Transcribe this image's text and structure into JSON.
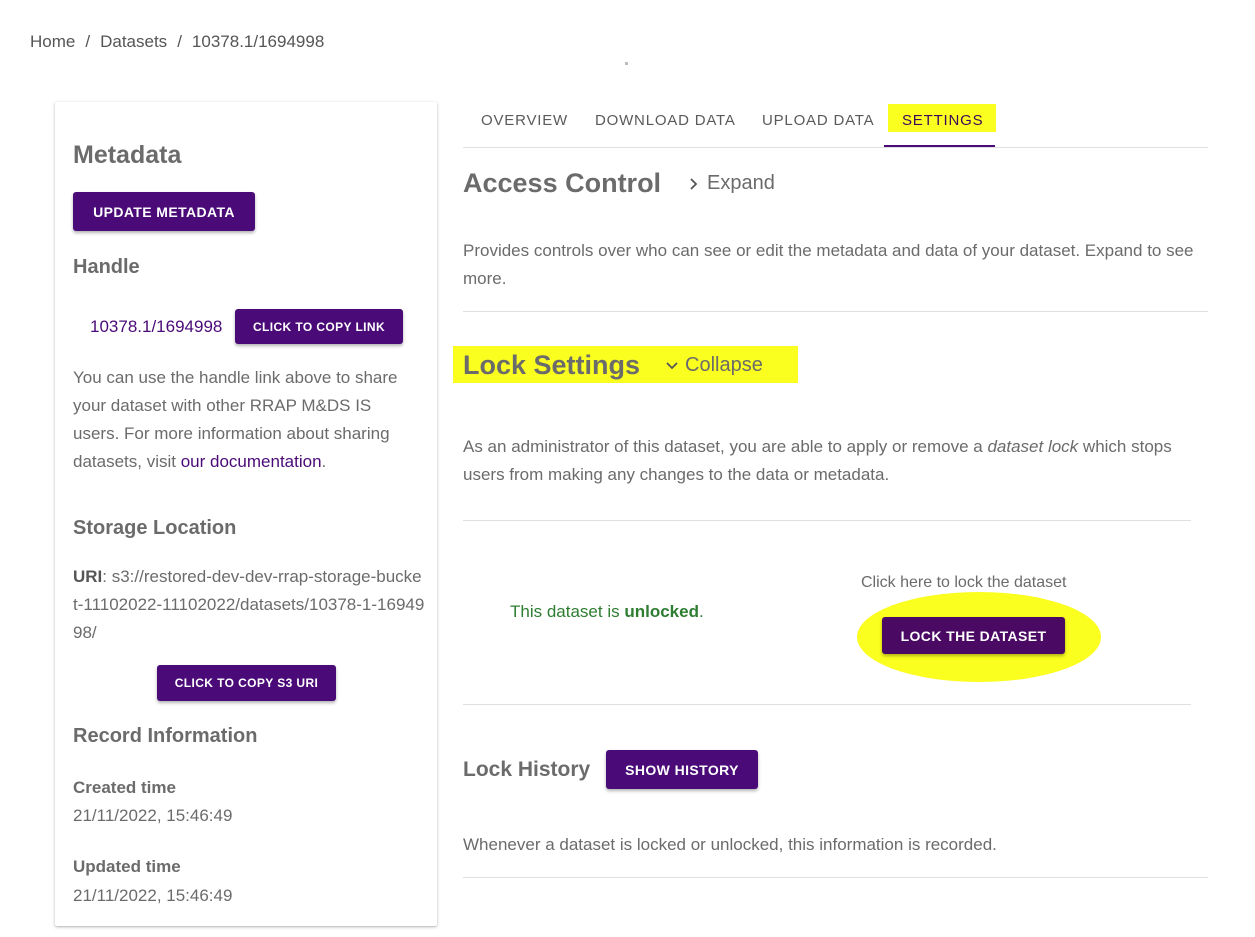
{
  "breadcrumb": {
    "home": "Home",
    "separator": "/",
    "datasets": "Datasets",
    "current": "10378.1/1694998"
  },
  "metadata_card": {
    "title": "Metadata",
    "update_button": "UPDATE METADATA",
    "handle_heading": "Handle",
    "handle_value": "10378.1/1694998",
    "copy_link_button": "CLICK TO COPY LINK",
    "handle_description": "You can use the handle link above to share your dataset with other RRAP M&DS IS users. For more information about sharing datasets, visit ",
    "documentation_link": "our documentation",
    "handle_description_end": ".",
    "storage_heading": "Storage Location",
    "uri_label": "URI",
    "uri_value": ": s3://restored-dev-dev-rrap-storage-bucket-11102022-11102022/datasets/10378-1-1694998/",
    "copy_s3_button": "CLICK TO COPY S3 URI",
    "record_heading": "Record Information",
    "created_label": "Created time",
    "created_value": "21/11/2022, 15:46:49",
    "updated_label": "Updated time",
    "updated_value": "21/11/2022, 15:46:49"
  },
  "tabs": [
    {
      "label": "OVERVIEW"
    },
    {
      "label": "DOWNLOAD DATA"
    },
    {
      "label": "UPLOAD DATA"
    },
    {
      "label": "SETTINGS",
      "active": true
    }
  ],
  "access_control": {
    "title": "Access Control",
    "toggle": "Expand",
    "description": "Provides controls over who can see or edit the metadata and data of your dataset. Expand to see more."
  },
  "lock_settings": {
    "title": "Lock Settings",
    "toggle": "Collapse",
    "description_start": "As an administrator of this dataset, you are able to apply or remove a ",
    "description_em": "dataset lock",
    "description_end": " which stops users from making any changes to the data or metadata.",
    "status_prefix": "This dataset is ",
    "status_value": "unlocked",
    "status_suffix": ".",
    "lock_hint": "Click here to lock the dataset",
    "lock_button": "LOCK THE DATASET"
  },
  "lock_history": {
    "title": "Lock History",
    "button": "SHOW HISTORY",
    "description": "Whenever a dataset is locked or unlocked, this information is recorded."
  },
  "colors": {
    "primary": "#4a0a77",
    "highlight": "#fbff1f",
    "status_green": "#2e7d32"
  }
}
